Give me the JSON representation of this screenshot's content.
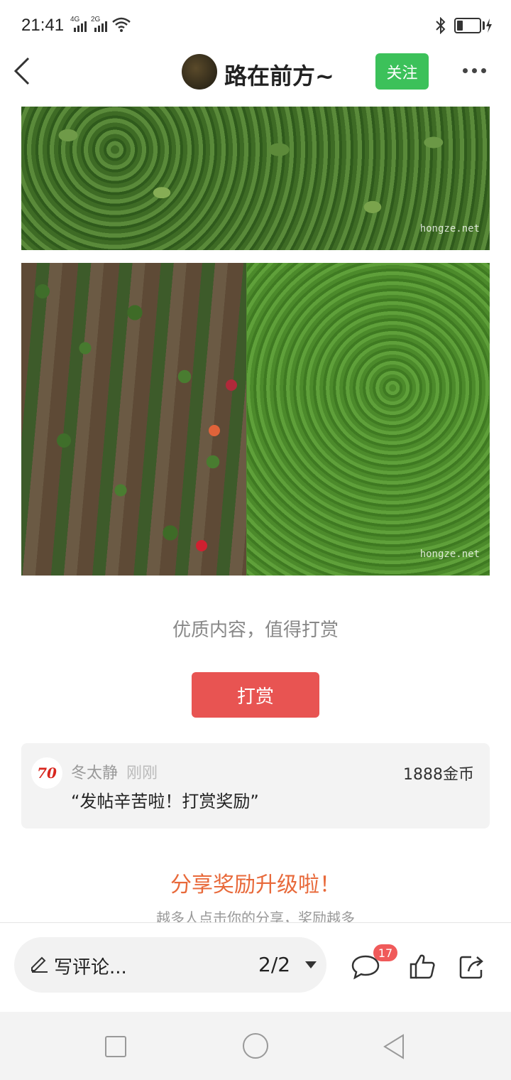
{
  "status_bar": {
    "time": "21:41",
    "network_1": "4G",
    "network_2": "2G"
  },
  "header": {
    "author_name": "路在前方~",
    "follow_label": "关注",
    "back_icon": "chevron-left-icon",
    "more_icon": "more-dots-icon"
  },
  "photos": [
    {
      "watermark": "hongze.net"
    },
    {
      "watermark": "hongze.net"
    }
  ],
  "reward": {
    "prompt": "优质内容，值得打赏",
    "button_label": "打赏",
    "record": {
      "name": "冬太静",
      "time": "刚刚",
      "coins": "1888金币",
      "message": "“发帖辛苦啦！打赏奖励”",
      "avatar_text": "70"
    }
  },
  "share": {
    "title": "分享奖励升级啦！",
    "subtitle": "越多人点击你的分享，奖励越多"
  },
  "bottom_bar": {
    "comment_placeholder": "写评论...",
    "page_indicator": "2/2",
    "comment_count": "17"
  },
  "colors": {
    "follow_green": "#3cc15a",
    "reward_red": "#e85452",
    "share_orange": "#e8693a",
    "badge_red": "#f05a5a"
  }
}
